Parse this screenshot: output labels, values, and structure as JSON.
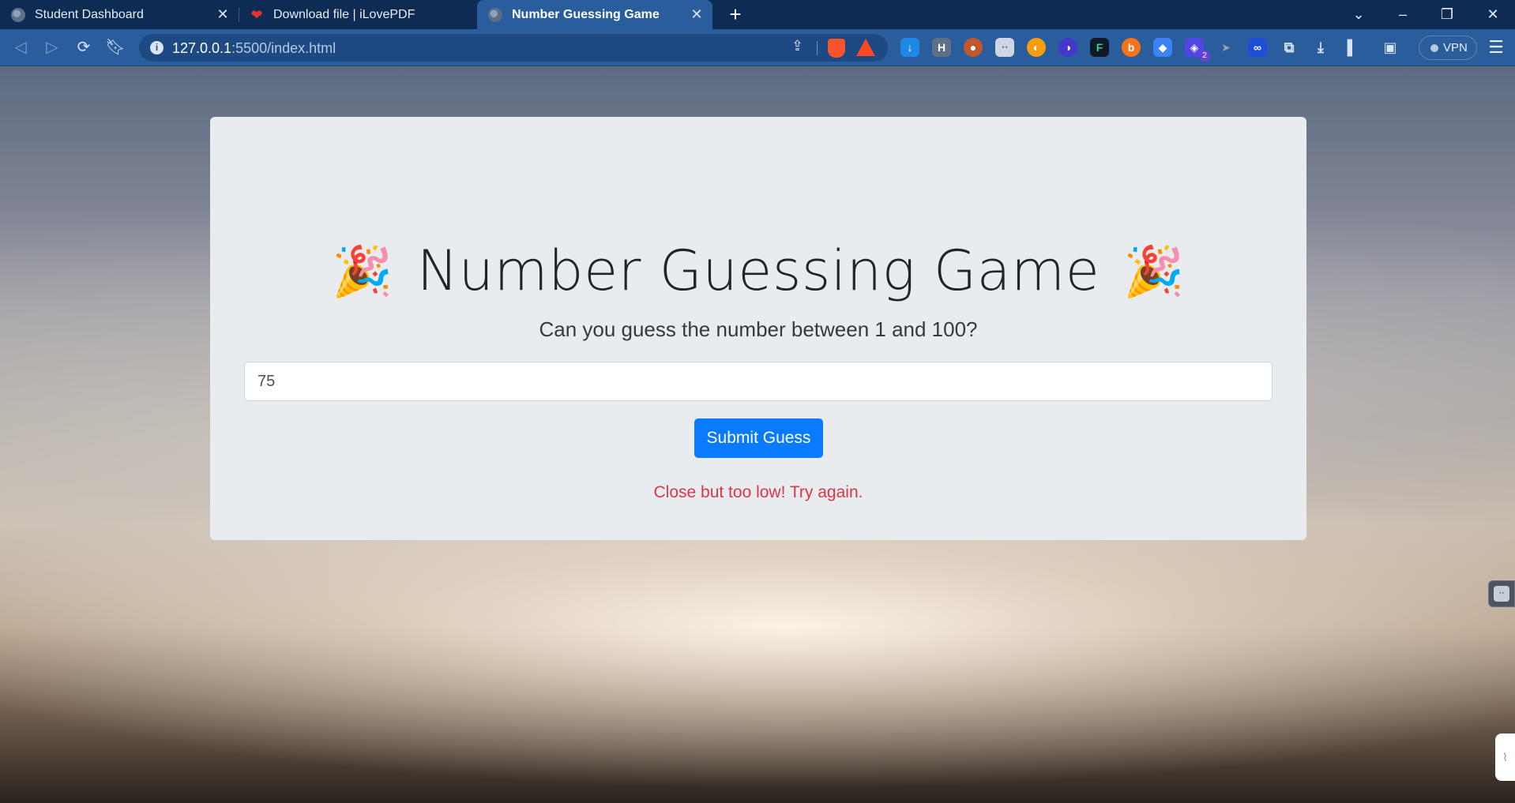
{
  "browser": {
    "tabs": [
      {
        "title": "Student Dashboard",
        "favicon": "globe-icon",
        "active": false
      },
      {
        "title": "Download file | iLovePDF",
        "favicon": "heart-icon",
        "active": false
      },
      {
        "title": "Number Guessing Game",
        "favicon": "globe-icon",
        "active": true
      }
    ],
    "tab_close_glyph": "✕",
    "new_tab_glyph": "+",
    "url_host": "127.0.0.1",
    "url_rest": ":5500/index.html",
    "vpn_label": "VPN",
    "extension_badge": "2",
    "colors": {
      "tabstrip": "#0d2b53",
      "toolbar": "#2a5d9c",
      "omnibox": "#1d4a83"
    }
  },
  "game": {
    "title": "Number Guessing Game",
    "emoji": "🎉",
    "subtitle": "Can you guess the number between 1 and 100?",
    "guess_value": "75",
    "submit_label": "Submit Guess",
    "feedback": "Close but too low! Try again.",
    "colors": {
      "card": "#e9ecef",
      "button": "#0a7bff",
      "feedback": "#dc3545"
    }
  }
}
